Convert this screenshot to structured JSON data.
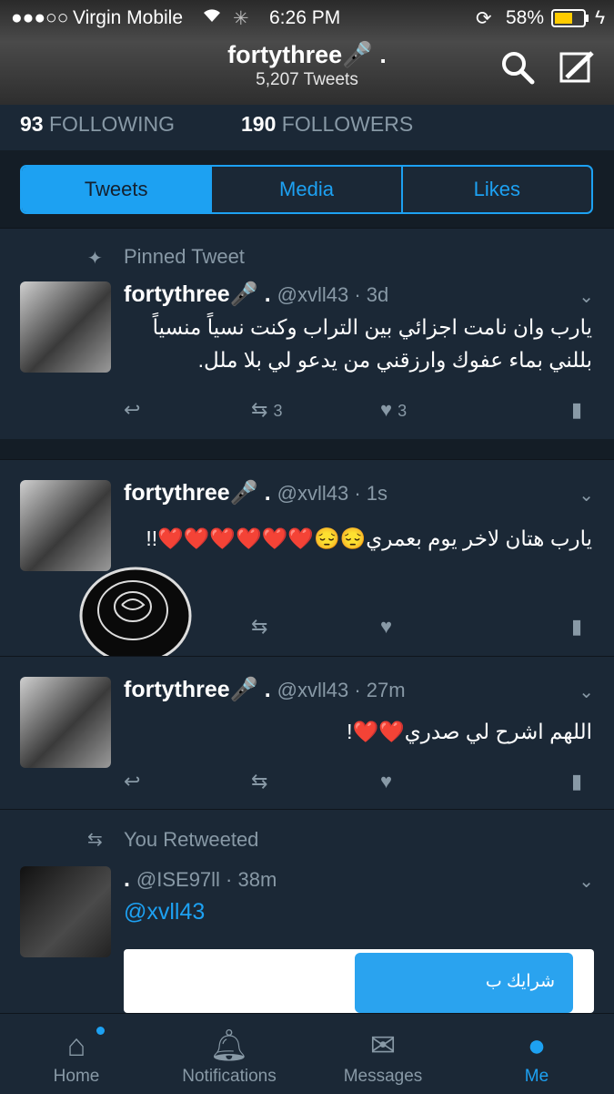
{
  "status_bar": {
    "signal": "●●●○○",
    "carrier": "Virgin Mobile",
    "time": "6:26 PM",
    "battery": "58%"
  },
  "header": {
    "title": "fortythree🎤 .",
    "subtitle": "5,207 Tweets",
    "icons": [
      "search-icon",
      "compose-icon"
    ]
  },
  "profile_counts": {
    "following_count": "93",
    "following_label": "FOLLOWING",
    "followers_count": "190",
    "followers_label": "FOLLOWERS"
  },
  "tabs": [
    "Tweets",
    "Media",
    "Likes"
  ],
  "tweets": [
    {
      "pinned_label": "Pinned Tweet",
      "name": "fortythree🎤 .",
      "handle": "@xvll43 · 3d",
      "text": "يارب وان نامت اجزائي بين التراب وكنت نسياً منسياً بللني بماء عفوك وارزقني من يدعو لي بلا ملل.",
      "retweets": "3",
      "likes": "3"
    },
    {
      "name": "fortythree🎤 .",
      "handle": "@xvll43 · 1s",
      "text": "يارب هتان لاخر يوم بعمري😔😔❤️❤️❤️❤️❤️❤️!!"
    },
    {
      "name": "fortythree🎤 .",
      "handle": "@xvll43 · 27m",
      "text": "اللهم اشرح لي صدري❤️❤️!"
    },
    {
      "retweeted_label": "You Retweeted",
      "name": ".",
      "handle": "@ISE97ll · 38m",
      "mention": "@xvll43",
      "card_text": "شرايك ب"
    }
  ],
  "tabbar": [
    "Home",
    "Notifications",
    "Messages",
    "Me"
  ],
  "colors": {
    "accent": "#1da1f2",
    "background": "#141d26",
    "panel": "#1b2836",
    "muted": "#8899a6"
  }
}
